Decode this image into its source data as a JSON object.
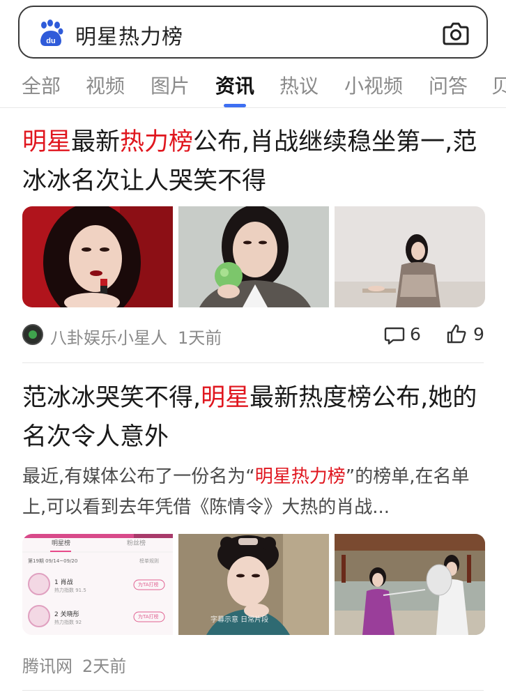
{
  "search": {
    "query": "明星热力榜",
    "logo_icon": "baidu-paw-icon",
    "camera_icon": "camera-icon"
  },
  "tabs": [
    {
      "label": "全部"
    },
    {
      "label": "视频"
    },
    {
      "label": "图片"
    },
    {
      "label": "资讯",
      "active": true
    },
    {
      "label": "热议"
    },
    {
      "label": "小视频"
    },
    {
      "label": "问答"
    },
    {
      "label": "贝"
    }
  ],
  "accent_color": "#3d6ff2",
  "highlight_color": "#e0161e",
  "articles": [
    {
      "title_parts": [
        {
          "text": "明星",
          "hl": true
        },
        {
          "text": "最新",
          "hl": false
        },
        {
          "text": "热力榜",
          "hl": true
        },
        {
          "text": "公布,肖战继续稳坐第一,范冰冰名次让人哭笑不得",
          "hl": false
        }
      ],
      "source": "八卦娱乐小星人",
      "time": "1天前",
      "comments": "6",
      "likes": "9"
    },
    {
      "title_parts": [
        {
          "text": "范冰冰哭笑不得,",
          "hl": false
        },
        {
          "text": "明星",
          "hl": true
        },
        {
          "text": "最新热度榜公布,她的名次令人意外",
          "hl": false
        }
      ],
      "summary_parts": [
        {
          "text": "最近,有媒体公布了一份名为“",
          "hl": false
        },
        {
          "text": "明星热力榜",
          "hl": true
        },
        {
          "text": "”的榜单,在名单上,可以看到去年凭借《陈情令》大热的肖战...",
          "hl": false
        }
      ],
      "source": "腾讯网",
      "time": "2天前",
      "thumb1": {
        "tab_left": "明星榜",
        "tab_right": "粉丝榜",
        "period": "第19期 09/14~09/20",
        "rule": "榜单规则",
        "rows": [
          {
            "rank_name": "1 肖战",
            "heat": "热力指数 91.5",
            "btn": "为TA打榜"
          },
          {
            "rank_name": "2 关晓彤",
            "heat": "热力指数 92",
            "btn": "为TA打榜"
          }
        ]
      },
      "thumb2": {
        "caption": "字幕示意  日常片段"
      }
    }
  ]
}
